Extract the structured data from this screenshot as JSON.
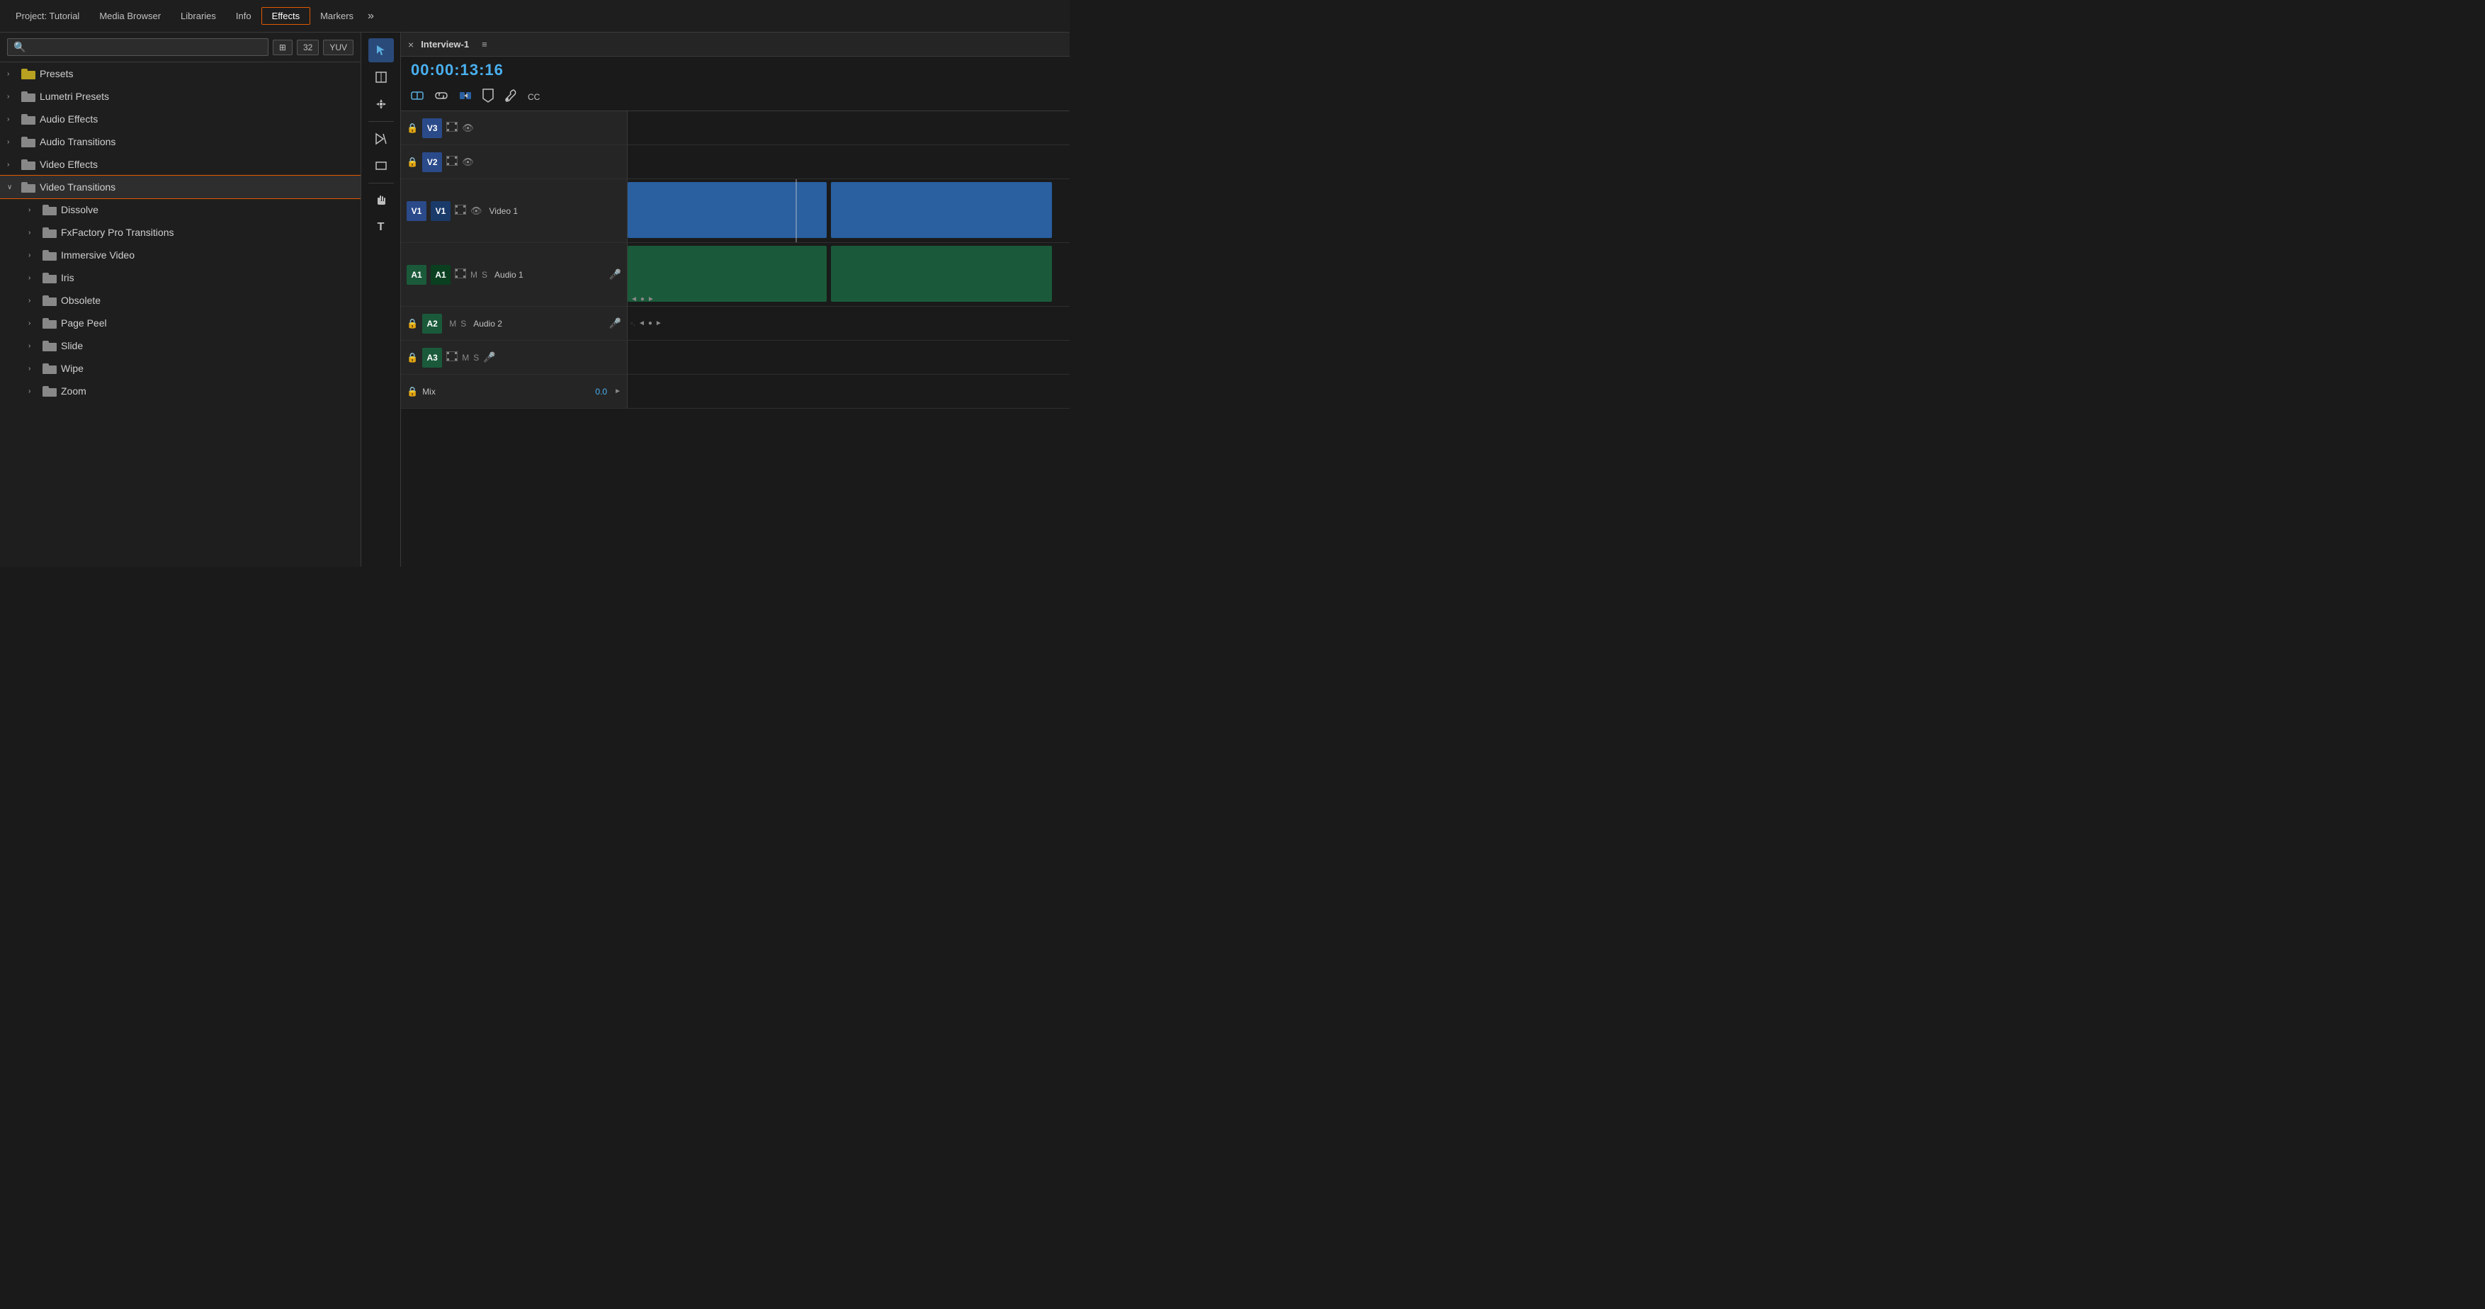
{
  "nav": {
    "items": [
      {
        "id": "project",
        "label": "Project: Tutorial",
        "active": false
      },
      {
        "id": "media-browser",
        "label": "Media Browser",
        "active": false
      },
      {
        "id": "libraries",
        "label": "Libraries",
        "active": false
      },
      {
        "id": "info",
        "label": "Info",
        "active": false
      },
      {
        "id": "effects",
        "label": "Effects",
        "active": true
      },
      {
        "id": "markers",
        "label": "Markers",
        "active": false
      }
    ],
    "more_label": "»"
  },
  "effects_panel": {
    "search_placeholder": "",
    "toolbar_buttons": [
      "⊞",
      "32",
      "YUV"
    ],
    "tree": [
      {
        "id": "presets",
        "label": "Presets",
        "level": 0,
        "expanded": false,
        "arrow": "›"
      },
      {
        "id": "lumetri",
        "label": "Lumetri Presets",
        "level": 0,
        "expanded": false,
        "arrow": "›"
      },
      {
        "id": "audio-effects",
        "label": "Audio Effects",
        "level": 0,
        "expanded": false,
        "arrow": "›"
      },
      {
        "id": "audio-transitions",
        "label": "Audio Transitions",
        "level": 0,
        "expanded": false,
        "arrow": "›"
      },
      {
        "id": "video-effects",
        "label": "Video Effects",
        "level": 0,
        "expanded": false,
        "arrow": "›"
      },
      {
        "id": "video-transitions",
        "label": "Video Transitions",
        "level": 0,
        "expanded": true,
        "arrow": "∨",
        "selected": true
      },
      {
        "id": "dissolve",
        "label": "Dissolve",
        "level": 1,
        "expanded": false,
        "arrow": "›"
      },
      {
        "id": "fxfactory",
        "label": "FxFactory Pro Transitions",
        "level": 1,
        "expanded": false,
        "arrow": "›"
      },
      {
        "id": "immersive",
        "label": "Immersive Video",
        "level": 1,
        "expanded": false,
        "arrow": "›"
      },
      {
        "id": "iris",
        "label": "Iris",
        "level": 1,
        "expanded": false,
        "arrow": "›"
      },
      {
        "id": "obsolete",
        "label": "Obsolete",
        "level": 1,
        "expanded": false,
        "arrow": "›"
      },
      {
        "id": "page-peel",
        "label": "Page Peel",
        "level": 1,
        "expanded": false,
        "arrow": "›"
      },
      {
        "id": "slide",
        "label": "Slide",
        "level": 1,
        "expanded": false,
        "arrow": "›"
      },
      {
        "id": "wipe",
        "label": "Wipe",
        "level": 1,
        "expanded": false,
        "arrow": "›"
      },
      {
        "id": "zoom",
        "label": "Zoom",
        "level": 1,
        "expanded": false,
        "arrow": "›"
      }
    ]
  },
  "tools": [
    {
      "id": "select",
      "icon": "▶",
      "active": true
    },
    {
      "id": "track-select",
      "icon": "⊞",
      "active": false
    },
    {
      "id": "move",
      "icon": "✥",
      "active": false
    },
    {
      "id": "razor",
      "icon": "✂",
      "active": false
    },
    {
      "id": "rect",
      "icon": "▭",
      "active": false
    },
    {
      "id": "hand",
      "icon": "✋",
      "active": false
    },
    {
      "id": "text",
      "icon": "T",
      "active": false
    }
  ],
  "timeline": {
    "close_label": "×",
    "title": "Interview-1",
    "menu_icon": "≡",
    "timecode": "00:00:13:16",
    "toolbar_tools": [
      "⊡",
      "⟳",
      "⊕",
      "⊘",
      "🔧",
      "CC"
    ],
    "tracks": [
      {
        "id": "v3",
        "label": "V3",
        "type": "video",
        "has_lock": true,
        "has_eye": true,
        "has_film": true,
        "has_clip": false
      },
      {
        "id": "v2",
        "label": "V2",
        "type": "video",
        "has_lock": true,
        "has_eye": true,
        "has_film": true,
        "has_clip": false
      },
      {
        "id": "v1",
        "label": "V1",
        "type": "video",
        "has_lock": false,
        "has_eye": true,
        "has_film": true,
        "has_clip": true,
        "clip_label": "Video 1",
        "track_name": "Video 1"
      },
      {
        "id": "a1",
        "label": "A1",
        "type": "audio",
        "has_lock": false,
        "has_eye": false,
        "has_film": true,
        "has_clip": true,
        "clip_label": "Audio 1",
        "track_name": "Audio 1",
        "buttons": [
          "M",
          "S"
        ]
      },
      {
        "id": "a2",
        "label": "A2",
        "type": "audio",
        "has_lock": true,
        "has_eye": false,
        "has_film": false,
        "has_clip": false,
        "track_name": "Audio 2",
        "buttons": [
          "M",
          "S"
        ]
      },
      {
        "id": "a3",
        "label": "A3",
        "type": "audio",
        "has_lock": true,
        "has_eye": false,
        "has_film": true,
        "has_clip": false,
        "buttons": [
          "M",
          "S"
        ]
      }
    ],
    "mix_label": "Mix",
    "mix_value": "0.0"
  }
}
